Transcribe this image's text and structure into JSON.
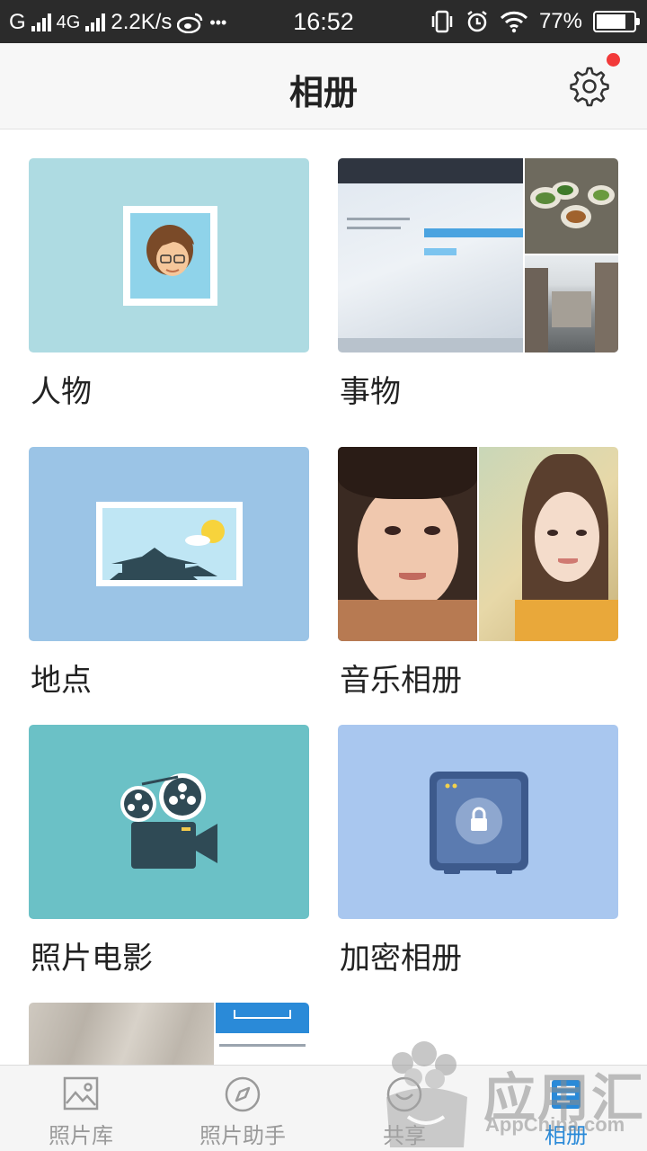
{
  "status_bar": {
    "carrier_g": "G",
    "carrier_4g": "4G",
    "speed": "2.2K/s",
    "more": "•••",
    "time": "16:52",
    "battery": "77%"
  },
  "header": {
    "title": "相册",
    "settings_icon": "gear-icon",
    "has_notification_dot": true
  },
  "albums": [
    {
      "label": "人物",
      "icon": "person-portrait-icon"
    },
    {
      "label": "事物",
      "icon": "photo-collage"
    },
    {
      "label": "地点",
      "icon": "landmark-picture-icon"
    },
    {
      "label": "音乐相册",
      "icon": "photo-collage"
    },
    {
      "label": "照片电影",
      "icon": "movie-projector-icon"
    },
    {
      "label": "加密相册",
      "icon": "safe-lock-icon"
    }
  ],
  "bottom_nav": {
    "items": [
      {
        "label": "照片库",
        "icon": "picture-icon",
        "active": false
      },
      {
        "label": "照片助手",
        "icon": "compass-icon",
        "active": false
      },
      {
        "label": "共享",
        "icon": "share-icon",
        "active": false
      },
      {
        "label": "相册",
        "icon": "album-icon",
        "active": true
      }
    ]
  },
  "watermark": {
    "name": "应用汇",
    "domain": "AppChina.com"
  },
  "colors": {
    "accent": "#2a8ad8",
    "notification": "#f23a3a",
    "people_bg": "#aedbe2",
    "places_bg": "#9bc4e6",
    "movie_bg": "#6bc1c6",
    "secret_bg": "#a9c7ef"
  }
}
